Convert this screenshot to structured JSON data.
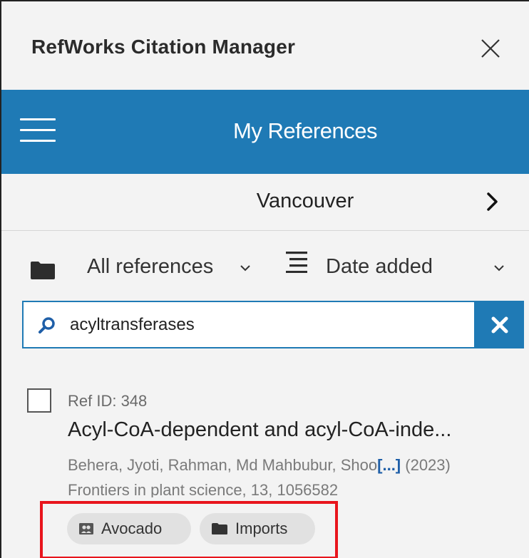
{
  "header": {
    "app_title": "RefWorks Citation Manager",
    "close_icon": "close-icon"
  },
  "nav": {
    "menu_icon": "hamburger-menu-icon",
    "title": "My References"
  },
  "citation_style": {
    "label": "Vancouver",
    "chevron_icon": "chevron-right-icon"
  },
  "filters": {
    "folder_label": "All references",
    "sort_label": "Date added"
  },
  "search": {
    "value": "acyltransferases",
    "clear_icon": "clear-icon"
  },
  "reference": {
    "ref_id": "Ref ID: 348",
    "title": "Acyl-CoA-dependent and acyl-CoA-inde...",
    "authors": "Behera, Jyoti, Rahman, Md Mahbubur, Shoo",
    "authors_more": "[...]",
    "year": " (2023)",
    "journal": "Frontiers in plant science, 13, 1056582",
    "tags": [
      {
        "label": "Avocado",
        "icon": "shared-folder-icon"
      },
      {
        "label": "Imports",
        "icon": "folder-icon"
      }
    ]
  },
  "colors": {
    "accent": "#1f7ab5",
    "background": "#f3f3f3",
    "highlight": "#e8141c",
    "tag_bg": "#e1e1e1"
  }
}
